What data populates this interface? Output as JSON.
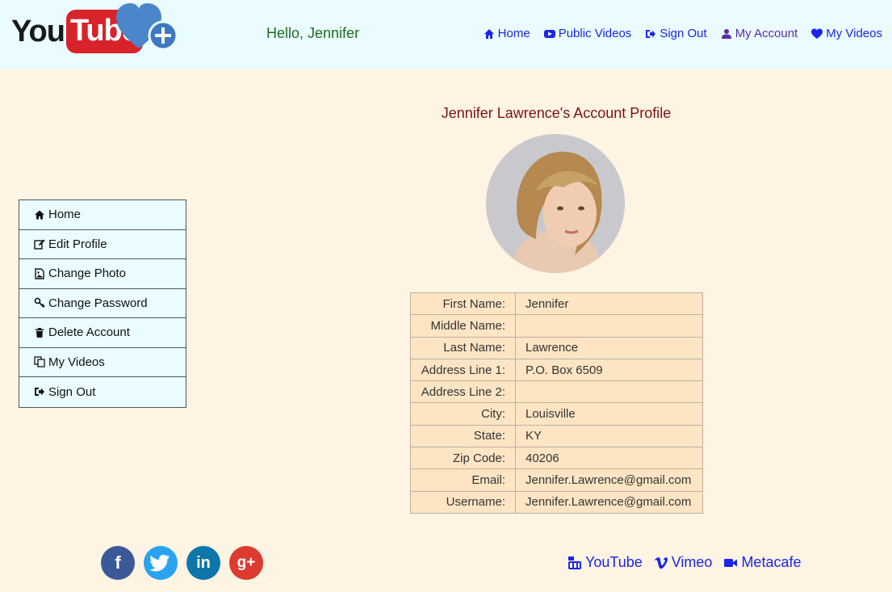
{
  "header": {
    "logo_you": "You",
    "logo_tube": "Tube",
    "greeting": "Hello, Jennifer",
    "nav": [
      {
        "label": "Home",
        "icon": "home-icon"
      },
      {
        "label": "Public Videos",
        "icon": "youtube-play-icon"
      },
      {
        "label": "Sign Out",
        "icon": "sign-out-icon"
      },
      {
        "label": "My Account",
        "icon": "user-icon"
      },
      {
        "label": "My Videos",
        "icon": "heart-icon"
      }
    ]
  },
  "page": {
    "title": "Jennifer Lawrence's Account Profile"
  },
  "sidebar": {
    "items": [
      {
        "label": "Home",
        "icon": "home-icon"
      },
      {
        "label": "Edit Profile",
        "icon": "edit-icon"
      },
      {
        "label": "Change Photo",
        "icon": "image-file-icon"
      },
      {
        "label": "Change Password",
        "icon": "key-icon"
      },
      {
        "label": "Delete Account",
        "icon": "trash-icon"
      },
      {
        "label": "My Videos",
        "icon": "copy-icon"
      },
      {
        "label": "Sign Out",
        "icon": "sign-out-icon"
      }
    ]
  },
  "profile": {
    "rows": [
      {
        "label": "First Name:",
        "value": "Jennifer"
      },
      {
        "label": "Middle Name:",
        "value": ""
      },
      {
        "label": "Last Name:",
        "value": "Lawrence"
      },
      {
        "label": "Address Line 1:",
        "value": "P.O. Box 6509"
      },
      {
        "label": "Address Line 2:",
        "value": ""
      },
      {
        "label": "City:",
        "value": "Louisville"
      },
      {
        "label": "State:",
        "value": "KY"
      },
      {
        "label": "Zip Code:",
        "value": "40206"
      },
      {
        "label": "Email:",
        "value": "Jennifer.Lawrence@gmail.com"
      },
      {
        "label": "Username:",
        "value": "Jennifer.Lawrence@gmail.com"
      }
    ]
  },
  "footer": {
    "social": [
      {
        "name": "facebook",
        "glyph": "f",
        "color": "#3b5998"
      },
      {
        "name": "twitter",
        "glyph": "t",
        "color": "#2aa3ef"
      },
      {
        "name": "linkedin",
        "glyph": "in",
        "color": "#0e76a8"
      },
      {
        "name": "google-plus",
        "glyph": "g+",
        "color": "#dd3a30"
      }
    ],
    "links": [
      {
        "label": "YouTube",
        "icon": "youtube-icon"
      },
      {
        "label": "Vimeo",
        "icon": "vimeo-icon"
      },
      {
        "label": "Metacafe",
        "icon": "video-camera-icon"
      }
    ]
  },
  "colors": {
    "header_bg": "#eafcff",
    "page_bg": "#fdf4e3",
    "link_blue": "#1a26e6",
    "title_red": "#7a1414",
    "greeting_green": "#1d6b1d",
    "table_cell_bg": "#fde5c4"
  }
}
